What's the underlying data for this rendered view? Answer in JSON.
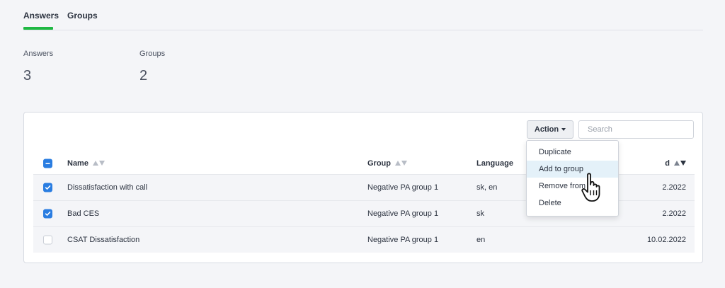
{
  "tabs": [
    {
      "label": "Answers",
      "active": true
    },
    {
      "label": "Groups",
      "active": false
    }
  ],
  "stats": [
    {
      "label": "Answers",
      "value": "3"
    },
    {
      "label": "Groups",
      "value": "2"
    }
  ],
  "toolbar": {
    "action_label": "Action",
    "search_placeholder": "Search"
  },
  "table": {
    "headers": {
      "name": "Name",
      "group": "Group",
      "language": "Language",
      "date_suffix": "d"
    },
    "rows": [
      {
        "name": "Dissatisfaction with call",
        "group": "Negative PA group 1",
        "language": "sk, en",
        "date": "2.2022",
        "checked": true
      },
      {
        "name": "Bad CES",
        "group": "Negative PA group 1",
        "language": "sk",
        "date": "2.2022",
        "checked": true
      },
      {
        "name": "CSAT Dissatisfaction",
        "group": "Negative PA group 1",
        "language": "en",
        "date": "10.02.2022",
        "checked": false
      }
    ]
  },
  "action_menu": {
    "items": [
      {
        "label": "Duplicate"
      },
      {
        "label": "Add to group",
        "hovered": true
      },
      {
        "label": "Remove from"
      },
      {
        "label": "Delete"
      }
    ]
  },
  "colors": {
    "accent_green": "#1fb843",
    "checkbox_blue": "#2a7de1",
    "menu_hover": "#e4f1f9"
  },
  "icons": {
    "cursor": "hand-pointer-icon",
    "sort": "sort-arrows-icon",
    "check": "check-icon",
    "indeterminate": "minus-icon"
  }
}
